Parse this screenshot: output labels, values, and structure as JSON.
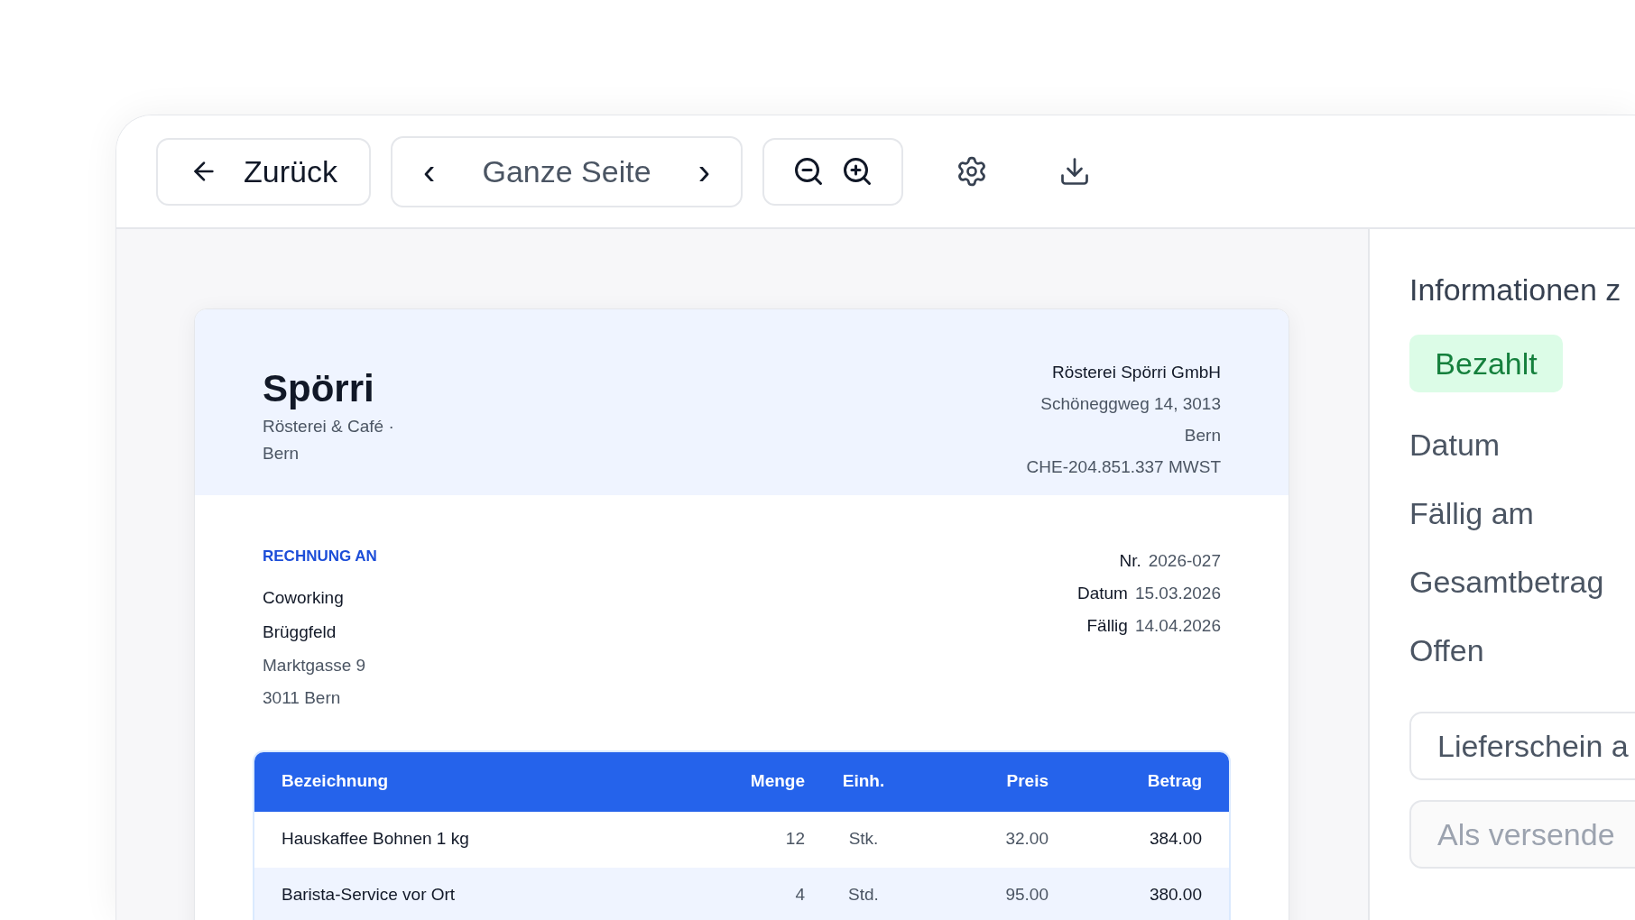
{
  "toolbar": {
    "back": {
      "label": "Zurück"
    },
    "page_nav": {
      "prev": "‹",
      "label": "Ganze Seite",
      "next": "›"
    }
  },
  "invoice": {
    "brand": "Spörri",
    "tagline": [
      "Rösterei & Café ·",
      "Bern"
    ],
    "sender": [
      "Rösterei Spörri GmbH",
      "Schöneggweg 14, 3013",
      "Bern",
      "CHE-204.851.337 MWST"
    ],
    "bill_to_label": "RECHNUNG AN",
    "recipient": [
      "Coworking",
      "Brüggfeld"
    ],
    "address": [
      "Marktgasse 9",
      "3011 Bern"
    ],
    "meta": [
      {
        "label": "Nr.",
        "value": "2026-027"
      },
      {
        "label": "Datum",
        "value": "15.03.2026"
      },
      {
        "label": "Fällig",
        "value": "14.04.2026"
      }
    ],
    "table": {
      "columns": [
        "Bezeichnung",
        "Menge",
        "Einh.",
        "Preis",
        "Betrag"
      ],
      "rows": [
        [
          "Hauskaffee Bohnen 1 kg",
          "12",
          "Stk.",
          "32.00",
          "384.00"
        ],
        [
          "Barista-Service vor Ort",
          "4",
          "Std.",
          "95.00",
          "380.00"
        ]
      ]
    }
  },
  "sidebar": {
    "title": "Informationen z",
    "status": {
      "label": "Bezahlt",
      "kind": "paid"
    },
    "fields": [
      "Datum",
      "Fällig am",
      "Gesamtbetrag",
      "Offen"
    ],
    "buttons": [
      {
        "label": "Lieferschein a",
        "disabled": false
      },
      {
        "label": "Als versende",
        "disabled": true
      }
    ]
  }
}
